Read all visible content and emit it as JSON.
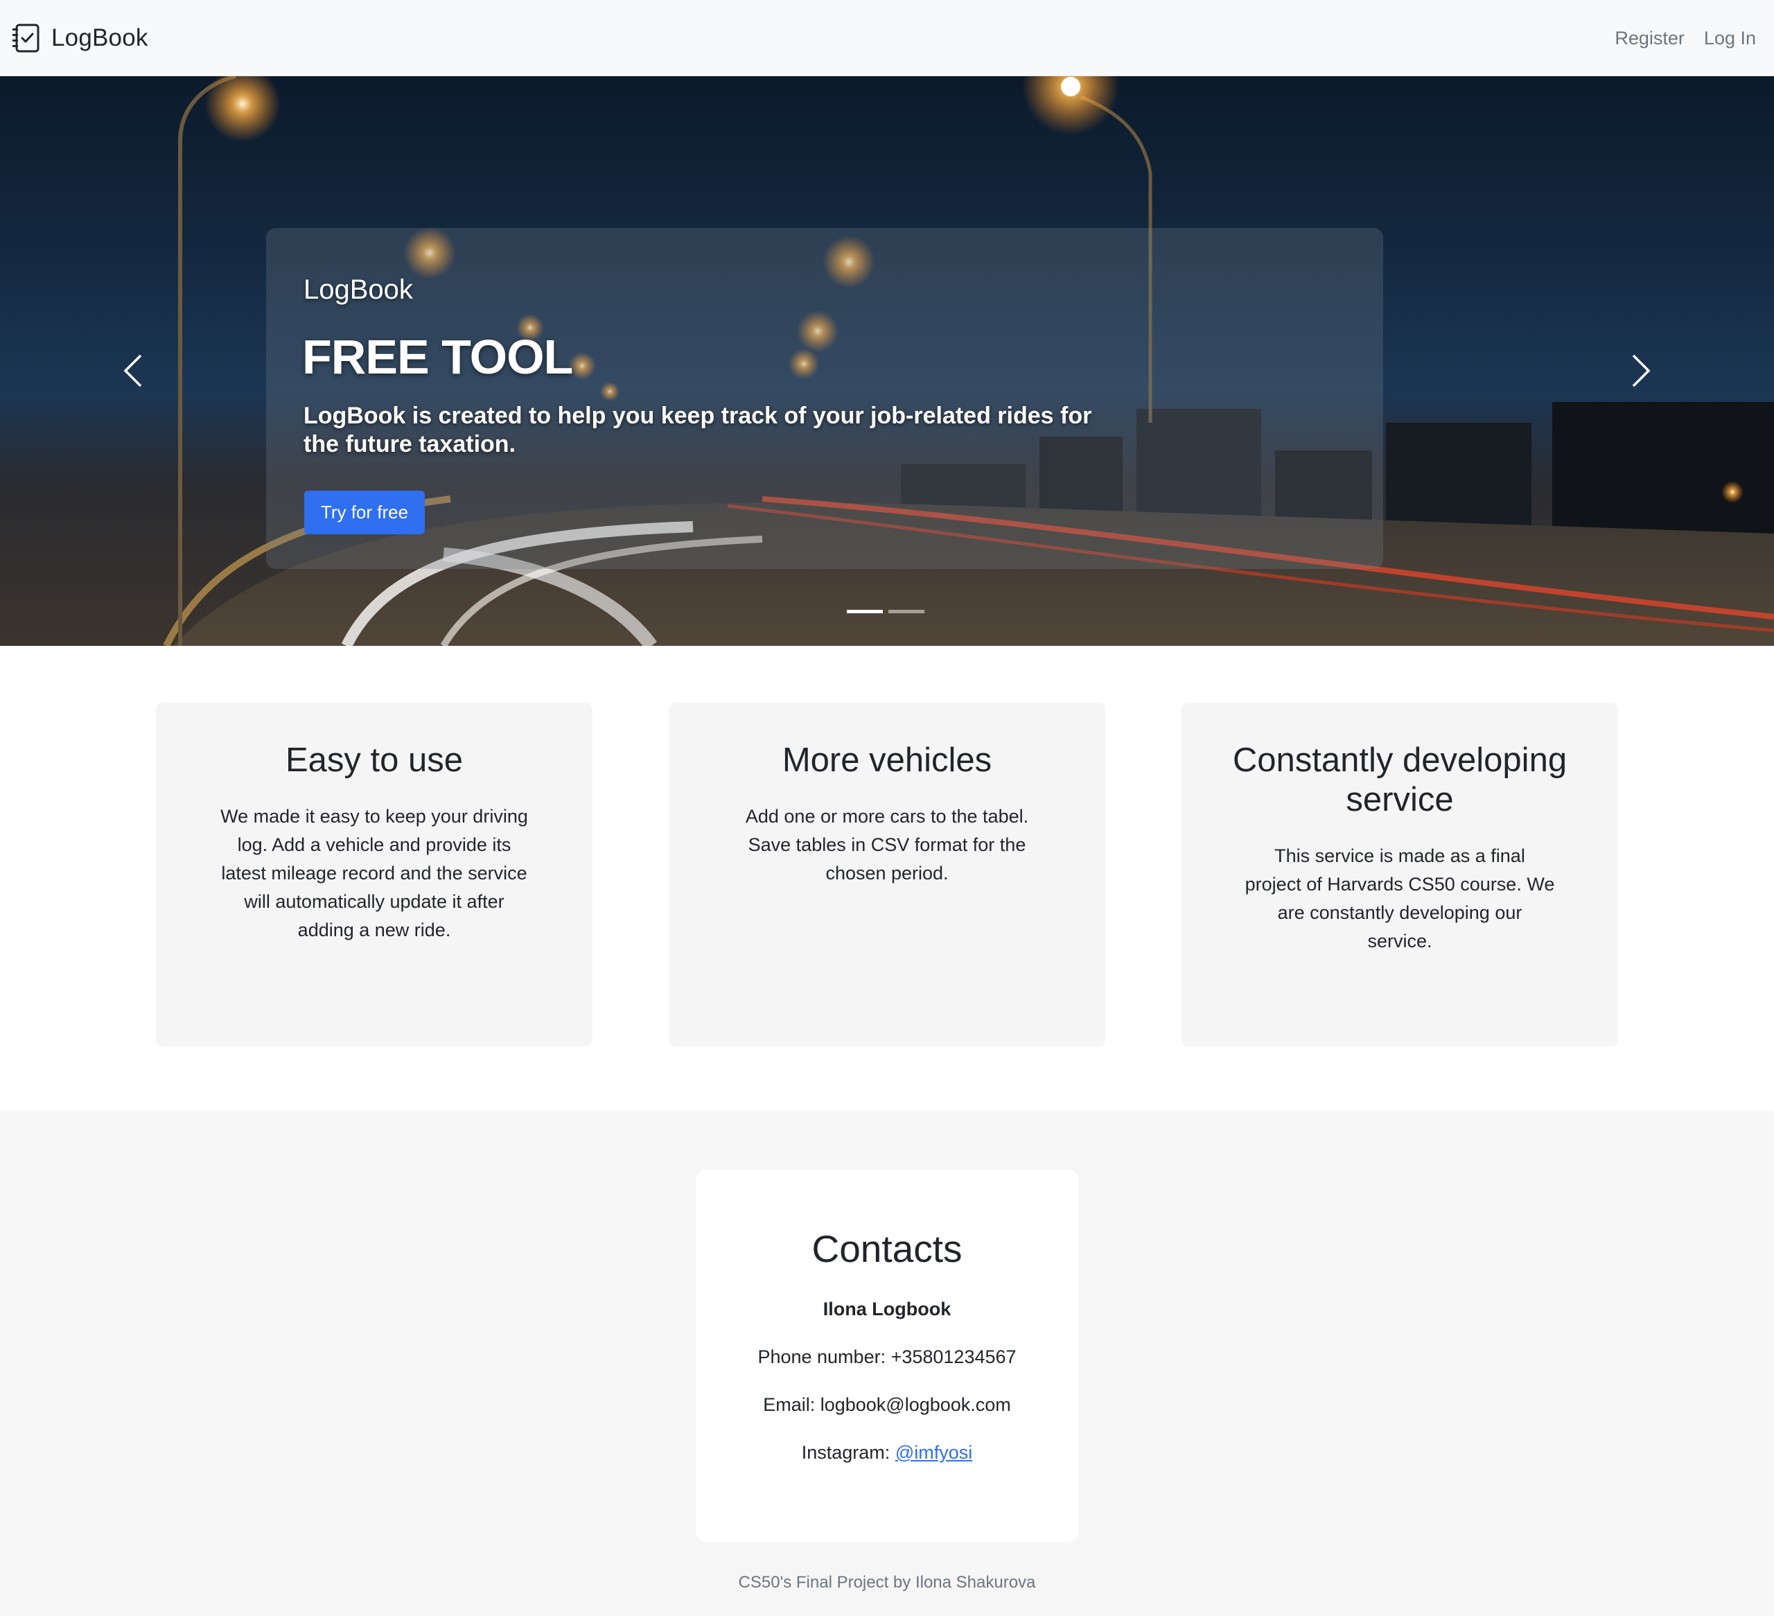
{
  "navbar": {
    "brand": "LogBook",
    "links": [
      {
        "label": "Register"
      },
      {
        "label": "Log In"
      }
    ]
  },
  "hero": {
    "kicker": "LogBook",
    "title": "FREE TOOL",
    "description": "LogBook is created to help you keep track of your job-related rides for the future taxation.",
    "button_label": "Try for free",
    "slide_count": 2,
    "active_slide": 1
  },
  "features": [
    {
      "title": "Easy to use",
      "text": "We made it easy to keep your driving log. Add a vehicle and provide its latest mileage record and the service will automatically update it after adding a new ride."
    },
    {
      "title": "More vehicles",
      "text": "Add one or more cars to the tabel. Save tables in CSV format for the chosen period."
    },
    {
      "title": "Constantly developing service",
      "text": "This service is made as a final project of Harvards CS50 course. We are constantly developing our service."
    }
  ],
  "contacts": {
    "title": "Contacts",
    "name": "Ilona Logbook",
    "phone": "Phone number: +35801234567",
    "email": "Email: logbook@logbook.com",
    "instagram_label": "Instagram: ",
    "instagram_handle": "@imfyosi"
  },
  "footer": {
    "text": "CS50's Final Project by Ilona Shakurova"
  },
  "colors": {
    "accent": "#2f6ff0",
    "navbar_bg": "#f8f9fa",
    "card_bg": "#f5f5f6",
    "section_bg": "#f6f6f7"
  },
  "icons": {
    "brand": "checklist-icon",
    "prev": "chevron-left-icon",
    "next": "chevron-right-icon"
  }
}
